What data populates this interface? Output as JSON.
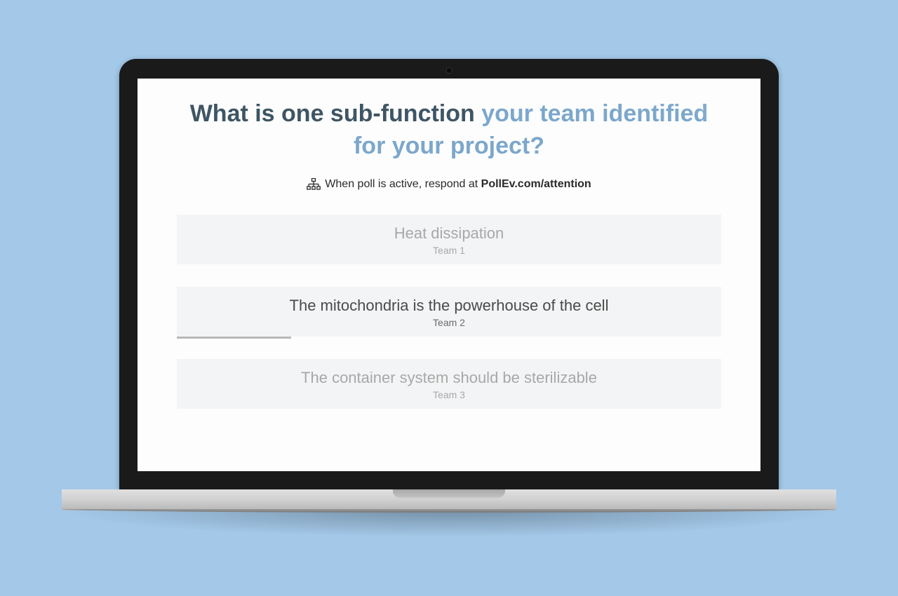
{
  "question": {
    "part1": "What is one sub-function ",
    "part2": "your team identified for your project?"
  },
  "instruction": {
    "prefix": "When poll is active, respond at ",
    "url": "PollEv.com/attention"
  },
  "responses": [
    {
      "text": "Heat dissipation",
      "team": "Team 1",
      "faded": true,
      "progress_pct": 0
    },
    {
      "text": "The mitochondria is the powerhouse of the cell",
      "team": "Team 2",
      "faded": false,
      "progress_pct": 21
    },
    {
      "text": "The container system should be sterilizable",
      "team": "Team 3",
      "faded": true,
      "progress_pct": 0
    }
  ]
}
